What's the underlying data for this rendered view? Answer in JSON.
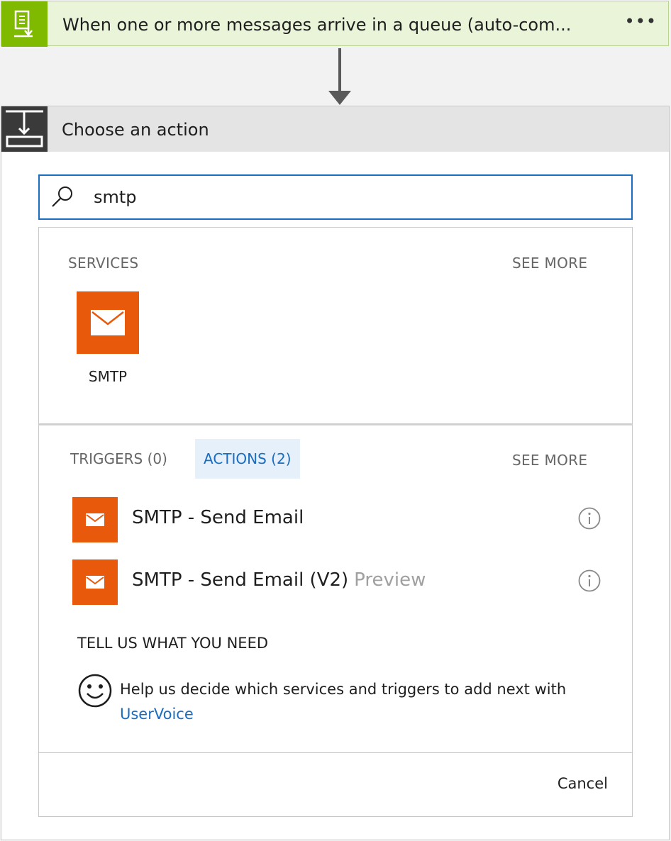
{
  "trigger": {
    "title": "When one or more messages arrive in a queue (auto-com...",
    "menu": "•••",
    "icon": "queue-document-icon",
    "color": "#7fba00"
  },
  "action_picker": {
    "title": "Choose an action",
    "icon": "choose-action-icon",
    "search": {
      "value": "smtp",
      "icon": "search-icon"
    },
    "services": {
      "heading": "SERVICES",
      "see_more": "SEE MORE",
      "items": [
        {
          "name": "SMTP",
          "icon": "mail-icon",
          "color": "#e8590c"
        }
      ]
    },
    "tabs": [
      {
        "label": "TRIGGERS (0)",
        "selected": false
      },
      {
        "label": "ACTIONS (2)",
        "selected": true
      }
    ],
    "see_more": "SEE MORE",
    "actions": [
      {
        "label": "SMTP - Send Email",
        "tag": "",
        "icon": "mail-icon",
        "info": "info-icon"
      },
      {
        "label": "SMTP - Send Email (V2)",
        "tag": "Preview",
        "icon": "mail-icon",
        "info": "info-icon"
      }
    ],
    "feedback": {
      "heading": "TELL US WHAT YOU NEED",
      "text_before": "Help us decide which services and triggers to add next with ",
      "link": "UserVoice",
      "icon": "smiley-icon"
    },
    "cancel": "Cancel",
    "accent_color": "#1a6dc0"
  }
}
